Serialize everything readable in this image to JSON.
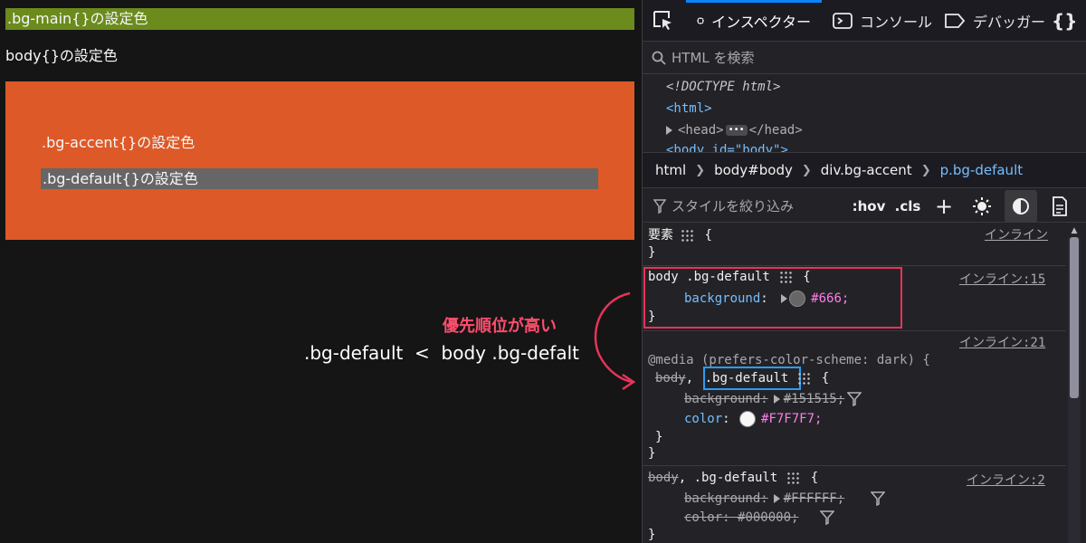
{
  "preview": {
    "bg_main_text": ".bg-main{}の設定色",
    "body_text": "body{}の設定色",
    "bg_accent_text": ".bg-accent{}の設定色",
    "bg_default_text": ".bg-default{}の設定色",
    "annotation_title": "優先順位が高い",
    "annotation_compare": ".bg-default  <  body .bg-defalt"
  },
  "devtools": {
    "tabs": [
      {
        "label": "インスペクター",
        "icon": "inspector-icon",
        "active": true
      },
      {
        "label": "コンソール",
        "icon": "console-icon",
        "active": false
      },
      {
        "label": "デバッガー",
        "icon": "debugger-icon",
        "active": false
      }
    ],
    "search_placeholder": "HTML を検索",
    "markup": {
      "doctype": "<!DOCTYPE html>",
      "html_tag": "<html>",
      "head_open": "<head>",
      "head_close": "</head>",
      "head_dots": "•••",
      "body_partial": "<body id=\"body\">"
    },
    "breadcrumb": [
      "html",
      "body#body",
      "div.bg-accent",
      "p.bg-default"
    ],
    "rules_toolbar": {
      "filter_placeholder": "スタイルを絞り込み",
      "hov": ":hov",
      "cls": ".cls",
      "add": "+"
    },
    "rules": {
      "element": {
        "selector": "要素",
        "open": "{",
        "close": "}",
        "source": "インライン"
      },
      "rule1": {
        "selector": "body .bg-default",
        "source": "インライン:15",
        "prop": "background",
        "value": "#666;",
        "swatch": "#666666"
      },
      "rule2": {
        "media": "@media (prefers-color-scheme: dark) {",
        "selector_a": "body",
        "selector_comma": ",",
        "selector_b": ".bg-default",
        "source": "インライン:21",
        "prop1": "background",
        "value1": "#151515;",
        "prop2": "color",
        "value2": "#F7F7F7;",
        "swatch2": "#F7F7F7"
      },
      "rule3": {
        "selector_a": "body",
        "selector_b": ", .bg-default",
        "source": "インライン:2",
        "prop1": "background",
        "value1": "#FFFFFF;",
        "prop2": "color",
        "value2": "#000000;"
      }
    }
  },
  "colors": {
    "bg_main": "#6b8b1d",
    "bg_accent": "#dd5927",
    "bg_default": "#666666",
    "page_bg": "#151515",
    "annotation": "#e8335a",
    "selector_box": "#2a9df4"
  }
}
